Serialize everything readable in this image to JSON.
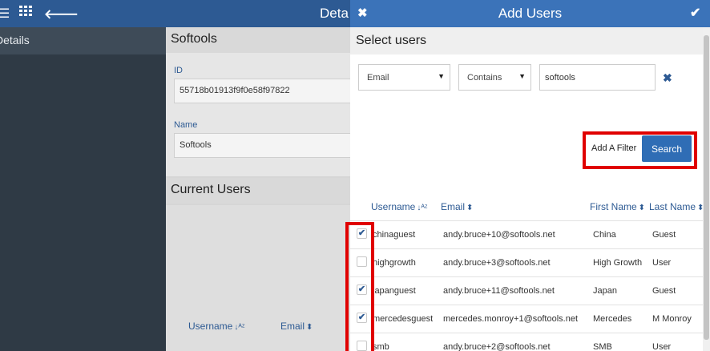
{
  "topbar": {
    "title": "Deta"
  },
  "sidebar": {
    "items": [
      {
        "label": "Details"
      }
    ]
  },
  "main": {
    "section_title": "Softools",
    "id_label": "ID",
    "id_value": "55718b01913f9f0e58f97822",
    "name_label": "Name",
    "name_value": "Softools",
    "current_users_title": "Current Users",
    "columns": [
      {
        "label": "Username"
      },
      {
        "label": "Email"
      }
    ]
  },
  "modal": {
    "title": "Add Users",
    "subtitle": "Select users",
    "filter": {
      "field": "Email",
      "operator": "Contains",
      "value": "softools"
    },
    "add_filter_label": "Add A Filter",
    "search_label": "Search",
    "columns": [
      "Username",
      "Email",
      "First Name",
      "Last Name"
    ],
    "rows": [
      {
        "checked": true,
        "username": "chinaguest",
        "email": "andy.bruce+10@softools.net",
        "first": "China",
        "last": "Guest"
      },
      {
        "checked": false,
        "username": "highgrowth",
        "email": "andy.bruce+3@softools.net",
        "first": "High Growth",
        "last": "User"
      },
      {
        "checked": true,
        "username": "japanguest",
        "email": "andy.bruce+11@softools.net",
        "first": "Japan",
        "last": "Guest"
      },
      {
        "checked": true,
        "username": "mercedesguest",
        "email": "mercedes.monroy+1@softools.net",
        "first": "Mercedes",
        "last": "M Monroy"
      },
      {
        "checked": false,
        "username": "smb",
        "email": "andy.bruce+2@softools.net",
        "first": "SMB",
        "last": "User"
      }
    ]
  },
  "colors": {
    "topbar": "#2d5a93",
    "modal_header": "#3b73b9",
    "accent": "#2f6db5",
    "highlight": "#e00000"
  }
}
